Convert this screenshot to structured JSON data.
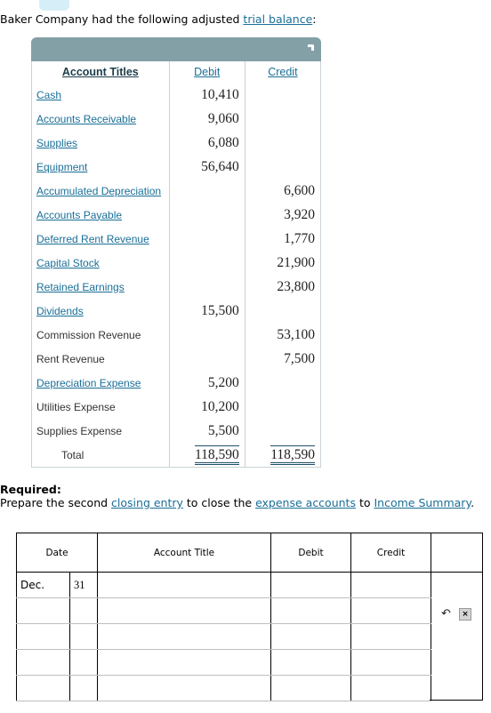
{
  "intro": {
    "text_before": "Baker Company had the following adjusted ",
    "link": "trial balance",
    "text_after": ":"
  },
  "trial_balance": {
    "headers": {
      "title": "Account Titles",
      "debit": "Debit",
      "credit": "Credit"
    },
    "rows": [
      {
        "title": "Cash",
        "linked": true,
        "debit": "10,410",
        "credit": ""
      },
      {
        "title": "Accounts Receivable",
        "linked": true,
        "debit": "9,060",
        "credit": ""
      },
      {
        "title": "Supplies",
        "linked": true,
        "debit": "6,080",
        "credit": ""
      },
      {
        "title": "Equipment",
        "linked": true,
        "debit": "56,640",
        "credit": ""
      },
      {
        "title": "Accumulated Depreciation",
        "linked": true,
        "debit": "",
        "credit": "6,600"
      },
      {
        "title": "Accounts Payable",
        "linked": true,
        "debit": "",
        "credit": "3,920"
      },
      {
        "title": "Deferred Rent Revenue",
        "linked": true,
        "debit": "",
        "credit": "1,770"
      },
      {
        "title": "Capital Stock",
        "linked": true,
        "debit": "",
        "credit": "21,900"
      },
      {
        "title": "Retained Earnings",
        "linked": true,
        "debit": "",
        "credit": "23,800"
      },
      {
        "title": "Dividends",
        "linked": true,
        "debit": "15,500",
        "credit": ""
      },
      {
        "title": "Commission Revenue",
        "linked": false,
        "debit": "",
        "credit": "53,100"
      },
      {
        "title": "Rent Revenue",
        "linked": false,
        "debit": "",
        "credit": "7,500"
      },
      {
        "title": "Depreciation Expense",
        "linked": true,
        "debit": "5,200",
        "credit": ""
      },
      {
        "title": "Utilities Expense",
        "linked": false,
        "debit": "10,200",
        "credit": ""
      },
      {
        "title": "Supplies Expense",
        "linked": false,
        "debit": "5,500",
        "credit": ""
      }
    ],
    "total": {
      "label": "Total",
      "debit": "118,590",
      "credit": "118,590"
    }
  },
  "required": {
    "heading": "Required:",
    "parts": [
      {
        "text": "Prepare the second "
      },
      {
        "link": "closing entry"
      },
      {
        "text": " to close the "
      },
      {
        "link": "expense accounts"
      },
      {
        "text": " to "
      },
      {
        "link": "Income Summary"
      },
      {
        "text": "."
      }
    ]
  },
  "journal": {
    "headers": {
      "date": "Date",
      "account_title": "Account Title",
      "debit": "Debit",
      "credit": "Credit"
    },
    "rows": [
      {
        "month": "Dec.",
        "day": "31",
        "account": "",
        "debit": "",
        "credit": ""
      },
      {
        "month": "",
        "day": "",
        "account": "",
        "debit": "",
        "credit": ""
      },
      {
        "month": "",
        "day": "",
        "account": "",
        "debit": "",
        "credit": ""
      },
      {
        "month": "",
        "day": "",
        "account": "",
        "debit": "",
        "credit": ""
      },
      {
        "month": "",
        "day": "",
        "account": "",
        "debit": "",
        "credit": ""
      }
    ],
    "actions": {
      "undo_icon": "undo-icon",
      "delete_icon": "close-icon",
      "delete_glyph": "×"
    }
  }
}
